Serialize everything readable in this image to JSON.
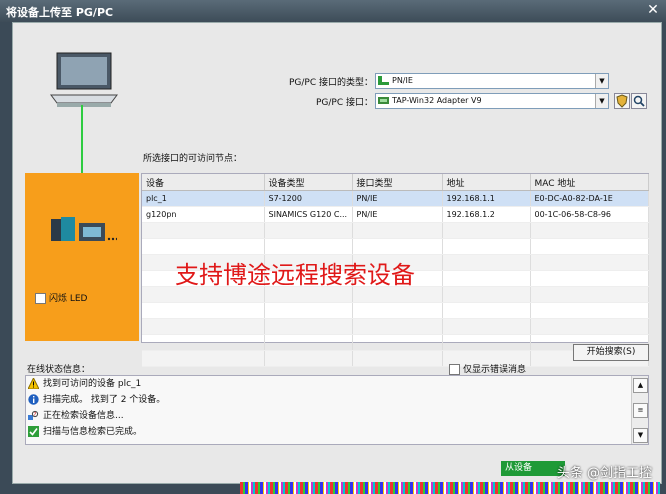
{
  "window": {
    "title": "将设备上传至 PG/PC",
    "close_glyph": "✕"
  },
  "interface": {
    "type_label": "PG/PC 接口的类型：",
    "type_value": "PN/IE",
    "iface_label": "PG/PC 接口：",
    "iface_value": "TAP-Win32 Adapter V9"
  },
  "nodes_label": "所选接口的可访问节点：",
  "table": {
    "headers": [
      "设备",
      "设备类型",
      "接口类型",
      "地址",
      "MAC 地址"
    ],
    "rows": [
      [
        "plc_1",
        "S7-1200",
        "PN/IE",
        "192.168.1.1",
        "E0-DC-A0-82-DA-1E"
      ],
      [
        "g120pn",
        "SINAMICS G120 C...",
        "PN/IE",
        "192.168.1.2",
        "00-1C-06-58-C8-96"
      ]
    ]
  },
  "watermark_text": "支持博途远程搜索设备",
  "flash_led_label": "闪烁 LED",
  "search_button": "开始搜索(S)",
  "status": {
    "label": "在线状态信息：",
    "show_errors_label": "仅显示错误消息",
    "messages": [
      {
        "icon": "warning-icon",
        "text": "找到可访问的设备 plc_1"
      },
      {
        "icon": "info-icon",
        "text": "扫描完成。 找到了 2 个设备。"
      },
      {
        "icon": "search-progress-icon",
        "text": "正在检索设备信息..."
      },
      {
        "icon": "check-icon",
        "text": "扫描与信息检索已完成。"
      }
    ]
  },
  "upload_button": "从设备",
  "footer_watermark": "头条 @剑指工控",
  "colors": {
    "accent_orange": "#f79e1b",
    "link_green": "#2ecc40",
    "selected_row": "#cfe0f5"
  }
}
